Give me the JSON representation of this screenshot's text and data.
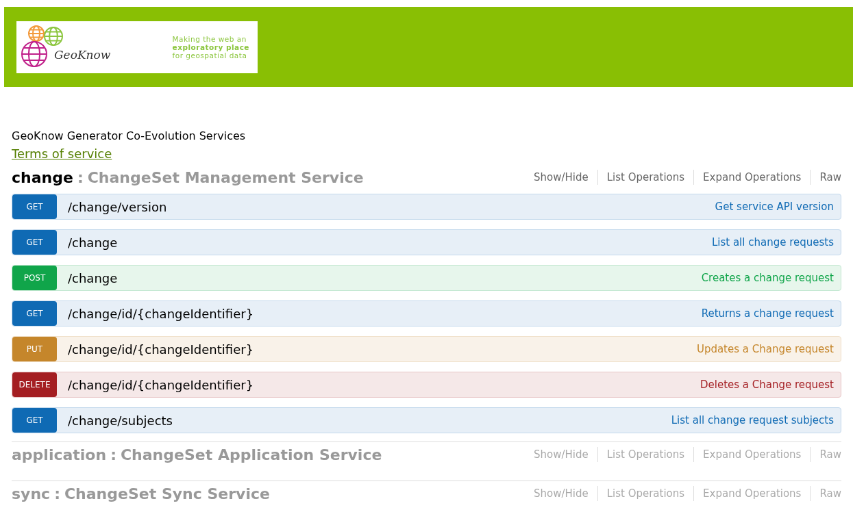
{
  "header": {
    "logo_name": "GeoKnow",
    "tagline": [
      "Making the web an",
      "exploratory place",
      "for geospatial data"
    ]
  },
  "info": {
    "title": "GeoKnow Generator Co-Evolution Services",
    "terms_link": "Terms of service"
  },
  "sections": [
    {
      "name": "change",
      "separator": ":",
      "description": "ChangeSet Management Service",
      "expanded": true,
      "links": [
        "Show/Hide",
        "List Operations",
        "Expand Operations",
        "Raw"
      ],
      "operations": [
        {
          "kind": "get",
          "method": "GET",
          "path": "/change/version",
          "summary": "Get service API version"
        },
        {
          "kind": "get",
          "method": "GET",
          "path": "/change",
          "summary": "List all change requests"
        },
        {
          "kind": "post",
          "method": "POST",
          "path": "/change",
          "summary": "Creates a change request"
        },
        {
          "kind": "get",
          "method": "GET",
          "path": "/change/id/{changeIdentifier}",
          "summary": "Returns a change request"
        },
        {
          "kind": "put",
          "method": "PUT",
          "path": "/change/id/{changeIdentifier}",
          "summary": "Updates a Change request"
        },
        {
          "kind": "delete",
          "method": "DELETE",
          "path": "/change/id/{changeIdentifier}",
          "summary": "Deletes a Change request"
        },
        {
          "kind": "get",
          "method": "GET",
          "path": "/change/subjects",
          "summary": "List all change request subjects"
        }
      ]
    },
    {
      "name": "application",
      "separator": ":",
      "description": "ChangeSet Application Service",
      "expanded": false,
      "links": [
        "Show/Hide",
        "List Operations",
        "Expand Operations",
        "Raw"
      ]
    },
    {
      "name": "sync",
      "separator": ":",
      "description": "ChangeSet Sync Service",
      "expanded": false,
      "links": [
        "Show/Hide",
        "List Operations",
        "Expand Operations",
        "Raw"
      ]
    }
  ]
}
